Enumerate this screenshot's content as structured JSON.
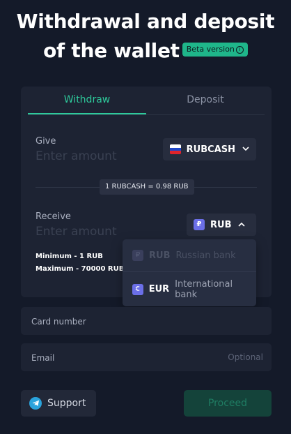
{
  "header": {
    "title_line1": "Withdrawal and deposit",
    "title_line2": "of the wallet",
    "beta_badge": "Beta version",
    "beta_info_icon": "info-icon"
  },
  "tabs": [
    {
      "label": "Withdraw",
      "active": true
    },
    {
      "label": "Deposit",
      "active": false
    }
  ],
  "give": {
    "label": "Give",
    "placeholder": "Enter amount",
    "currency": "RUBCASH",
    "currency_icon": "russia-flag-icon",
    "chevron": "chevron-down-icon"
  },
  "rate": "1 RUBCASH = 0.98 RUB",
  "receive": {
    "label": "Receive",
    "placeholder": "Enter amount",
    "currency": "RUB",
    "currency_icon": "ruble-icon",
    "currency_symbol": "₽",
    "chevron": "chevron-up-icon"
  },
  "limits": {
    "minimum": "Minimum - 1 RUB",
    "maximum": "Maximum - 70000 RUB"
  },
  "dropdown": {
    "options": [
      {
        "code": "RUB",
        "symbol": "₽",
        "description": "Russian bank",
        "disabled": true
      },
      {
        "code": "EUR",
        "symbol": "€",
        "description": "International bank",
        "disabled": false
      }
    ]
  },
  "card_number": {
    "placeholder": "Card number"
  },
  "email": {
    "placeholder": "Email",
    "optional": "Optional"
  },
  "footer": {
    "support_label": "Support",
    "support_icon": "telegram-icon",
    "proceed_label": "Proceed"
  },
  "colors": {
    "background": "#141a29",
    "card": "#1d2333",
    "accent": "#2ec99b",
    "beta": "#1fb68a",
    "proceed_disabled": "#14433a"
  }
}
